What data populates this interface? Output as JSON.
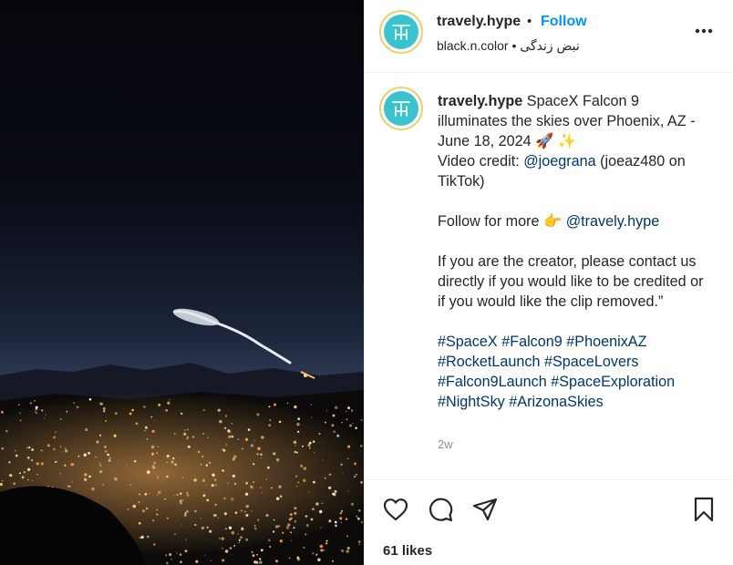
{
  "post": {
    "username": "travely.hype",
    "separator": "•",
    "follow_label": "Follow",
    "audio_user": "black.n.color",
    "audio_sep": "•",
    "audio_title": "نبض زندگی",
    "avatar_monogram": "TH"
  },
  "caption": {
    "username": "travely.hype",
    "line1": "SpaceX Falcon 9 illuminates the skies over Phoenix, AZ - June 18, 2024 🚀 ✨",
    "credit_prefix": "Video credit: ",
    "credit_handle": "@joegrana",
    "credit_suffix": " (joeaz480 on TikTok)",
    "follow_prefix": "Follow for more 👉 ",
    "follow_handle": "@travely.hype",
    "creator_note": "If you are the creator, please contact us directly if you would like to be credited or if you would like the clip removed.”",
    "hashtags": "#SpaceX #Falcon9 #PhoenixAZ #RocketLaunch #SpaceLovers #Falcon9Launch #SpaceExploration #NightSky #ArizonaSkies",
    "timestamp": "2w"
  },
  "actions": {
    "like_icon": "heart-icon",
    "comment_icon": "comment-icon",
    "share_icon": "send-icon",
    "save_icon": "bookmark-icon",
    "likes_text": "61 likes"
  },
  "colors": {
    "follow_blue": "#0095f6",
    "hashtag": "#00376b",
    "avatar_bg": "#39c3cf"
  }
}
